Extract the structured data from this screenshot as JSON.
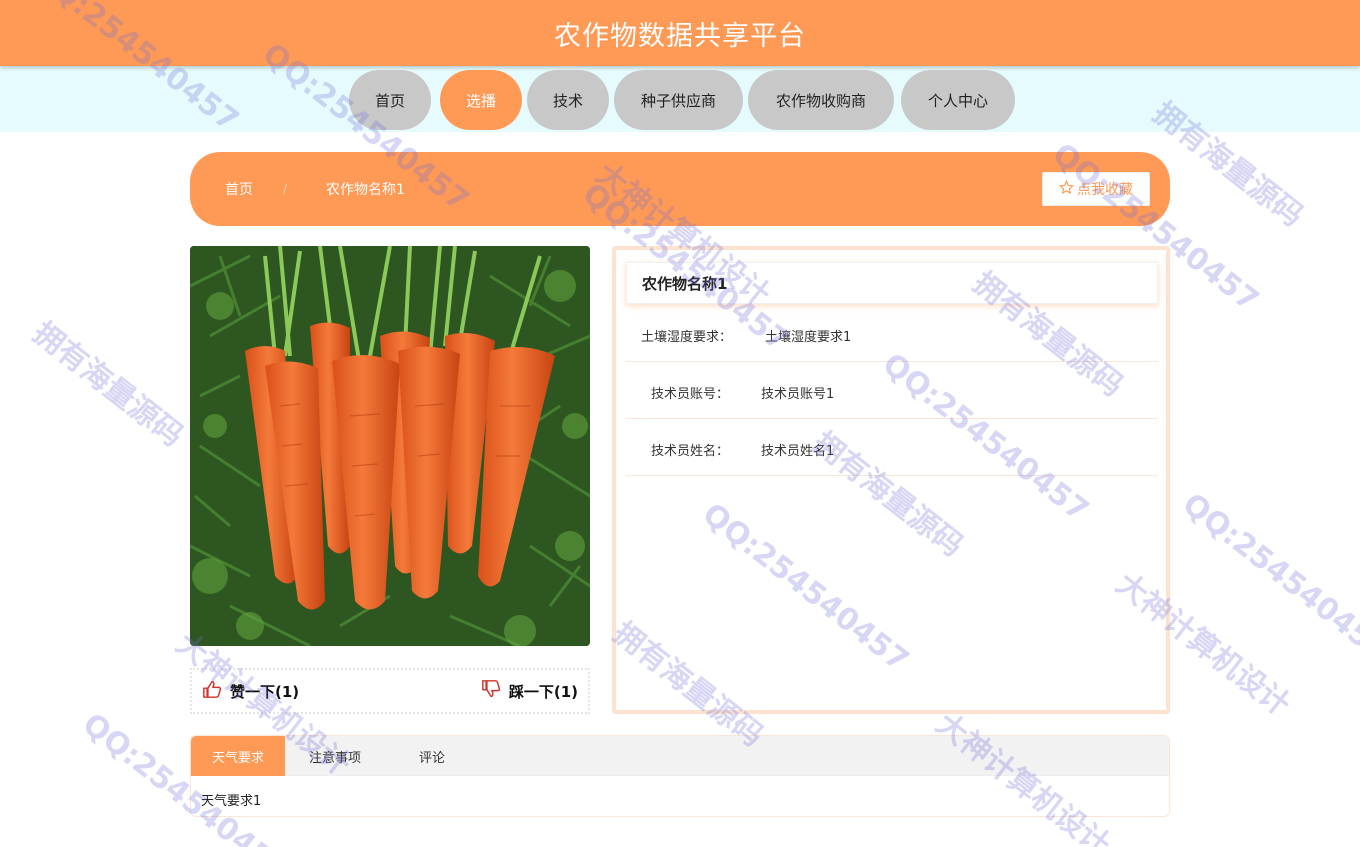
{
  "header": {
    "title": "农作物数据共享平台"
  },
  "nav": {
    "items": [
      {
        "label": "首页"
      },
      {
        "label": "选播"
      },
      {
        "label": "技术"
      },
      {
        "label": "种子供应商"
      },
      {
        "label": "农作物收购商"
      },
      {
        "label": "个人中心"
      }
    ],
    "active_index": 1
  },
  "breadcrumb": {
    "home": "首页",
    "separator": "/",
    "current": "农作物名称1"
  },
  "favorite": {
    "icon": "star-outline-icon",
    "label": "点我收藏"
  },
  "votes": {
    "like": {
      "icon": "thumbs-up-icon",
      "label": "赞一下(1)"
    },
    "dislike": {
      "icon": "thumbs-down-icon",
      "label": "踩一下(1)"
    }
  },
  "info": {
    "title": "农作物名称1",
    "rows": [
      {
        "label": "土壤湿度要求：",
        "value": "土壤湿度要求1"
      },
      {
        "label": "技术员账号：",
        "value": "技术员账号1"
      },
      {
        "label": "技术员姓名：",
        "value": "技术员姓名1"
      }
    ]
  },
  "tabs": {
    "items": [
      {
        "label": "天气要求"
      },
      {
        "label": "注意事项"
      },
      {
        "label": "评论"
      }
    ],
    "active_index": 0,
    "content": "天气要求1"
  },
  "watermarks": {
    "qq": "QQ:254540457",
    "source": "拥有海量源码",
    "design": "大神计算机设计"
  },
  "colors": {
    "accent": "#fe9a55",
    "nav_inactive": "#c8c8c8",
    "nav_band": "#e6fbfd",
    "panel_border": "#fde3cf",
    "vote_icon": "#d0342c"
  }
}
